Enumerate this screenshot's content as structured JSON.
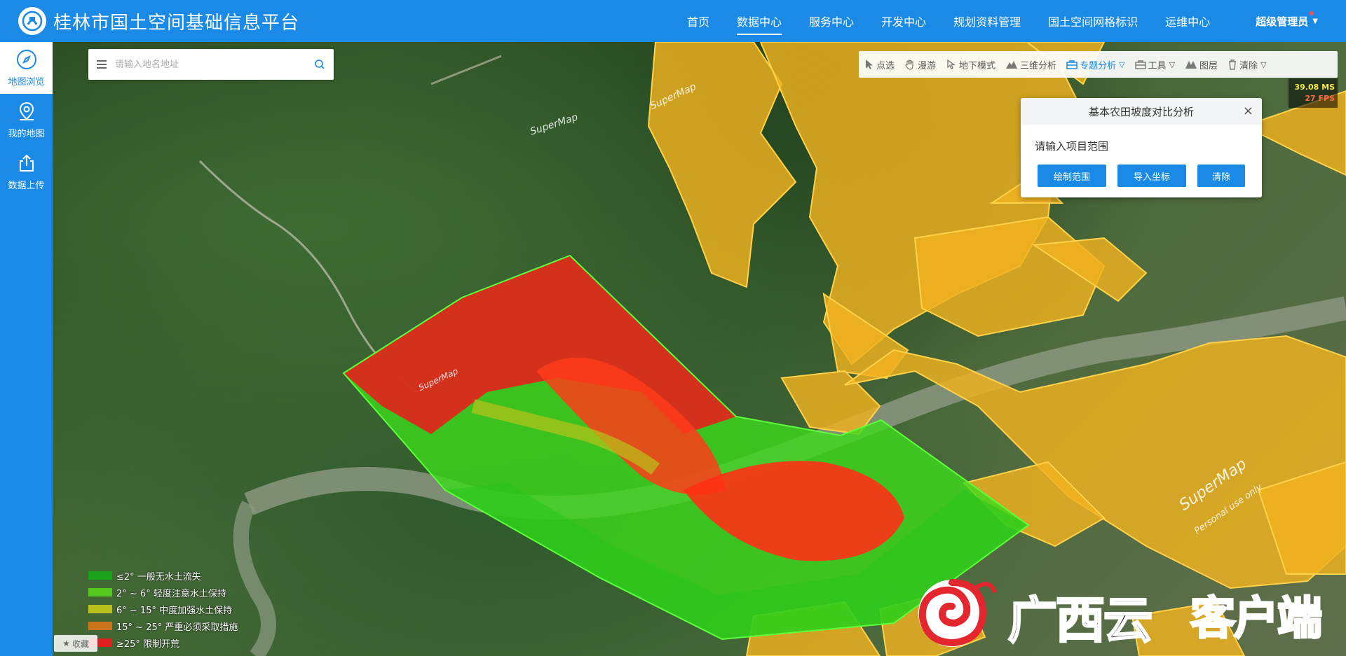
{
  "header": {
    "title": "桂林市国土空间基础信息平台",
    "nav": [
      "首页",
      "数据中心",
      "服务中心",
      "开发中心",
      "规划资料管理",
      "国土空间网格标识",
      "运维中心"
    ],
    "active_nav": "数据中心",
    "user": "超级管理员"
  },
  "sidebar": {
    "items": [
      {
        "label": "地图浏览",
        "icon": "compass-icon",
        "active": true
      },
      {
        "label": "我的地图",
        "icon": "location-pin-icon",
        "active": false
      },
      {
        "label": "数据上传",
        "icon": "upload-icon",
        "active": false
      }
    ]
  },
  "search": {
    "placeholder": "请输入地名地址"
  },
  "toolbar": {
    "items": [
      {
        "label": "点选",
        "icon": "cursor-icon"
      },
      {
        "label": "漫游",
        "icon": "hand-icon"
      },
      {
        "label": "地下模式",
        "icon": "underground-icon"
      },
      {
        "label": "三维分析",
        "icon": "terrain-icon"
      },
      {
        "label": "专题分析",
        "icon": "briefcase-icon",
        "active": true,
        "dropdown": true
      },
      {
        "label": "工具",
        "icon": "toolbox-icon",
        "dropdown": true
      },
      {
        "label": "图层",
        "icon": "layers-icon"
      },
      {
        "label": "清除",
        "icon": "trash-icon",
        "dropdown": true
      }
    ]
  },
  "perf": {
    "ms": "39.08 MS",
    "fps": "27 FPS"
  },
  "panel": {
    "title": "基本农田坡度对比分析",
    "prompt": "请输入项目范围",
    "buttons": [
      "绘制范围",
      "导入坐标",
      "清除"
    ]
  },
  "legend": [
    {
      "label": "≤2° 一般无水土流失",
      "color": "#1aa31a"
    },
    {
      "label": "2° ~ 6° 轻度注意水土保持",
      "color": "#55c81d"
    },
    {
      "label": "6° ~ 15° 中度加强水土保持",
      "color": "#b9c21a"
    },
    {
      "label": "15° ~ 25° 严重必须采取措施",
      "color": "#c8741a"
    },
    {
      "label": "≥25° 限制开荒",
      "color": "#e01e1e"
    }
  ],
  "favorite": "收藏",
  "watermark": {
    "brand": "广西云",
    "suffix": "客户端"
  },
  "map_labels": [
    "SuperMap",
    "Personal use only"
  ],
  "colors": {
    "primary": "#1a8ae6",
    "farmland": "#f2b21e",
    "slope_high": "#e81c1c",
    "slope_low": "#3ddb1c"
  }
}
